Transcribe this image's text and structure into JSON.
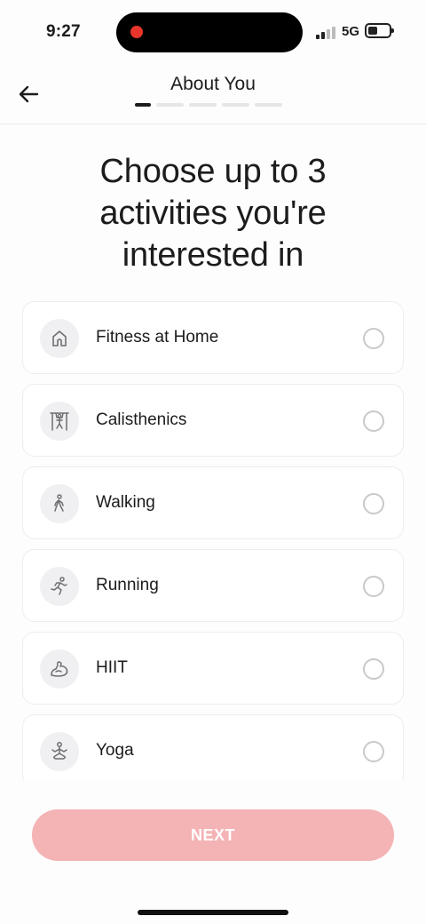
{
  "status_bar": {
    "time": "9:27",
    "network": "5G",
    "recording_color": "#e8352b"
  },
  "header": {
    "title": "About You",
    "back_icon": "arrow-left-icon",
    "progress_steps": 5,
    "progress_current": 1
  },
  "heading": "Choose up to 3 activities you're interested in",
  "activities": [
    {
      "label": "Fitness at Home",
      "icon": "house-icon",
      "selected": false
    },
    {
      "label": "Calisthenics",
      "icon": "calisthenics-icon",
      "selected": false
    },
    {
      "label": "Walking",
      "icon": "walking-icon",
      "selected": false
    },
    {
      "label": "Running",
      "icon": "running-icon",
      "selected": false
    },
    {
      "label": "HIIT",
      "icon": "flexed-arm-icon",
      "selected": false
    },
    {
      "label": "Yoga",
      "icon": "yoga-icon",
      "selected": false
    }
  ],
  "next_button": {
    "label": "NEXT",
    "enabled": false,
    "color": "#f4b3b5"
  }
}
